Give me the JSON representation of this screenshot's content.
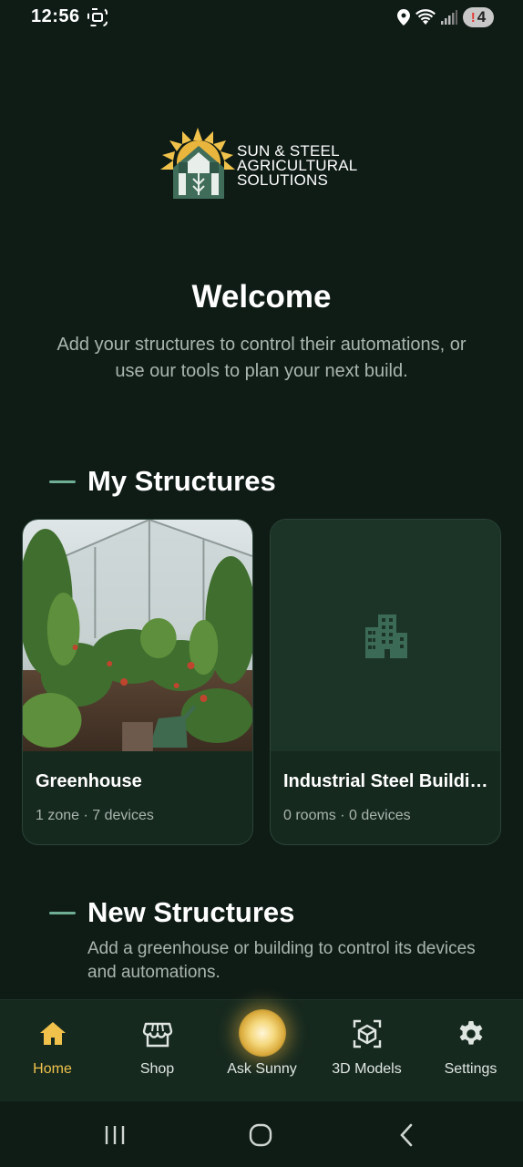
{
  "status_bar": {
    "time": "12:56",
    "battery_level": "4",
    "battery_alert": "!"
  },
  "logo": {
    "line1": "SUN & STEEL",
    "line2": "AGRICULTURAL",
    "line3": "SOLUTIONS"
  },
  "welcome": {
    "title": "Welcome",
    "subtitle": "Add your structures to control their automations, or use our tools to plan your next build."
  },
  "my_structures": {
    "heading": "My Structures",
    "cards": [
      {
        "title": "Greenhouse",
        "meta": "1 zone · 7 devices",
        "icon": "greenhouse-photo"
      },
      {
        "title": "Industrial Steel Building",
        "meta": "0 rooms · 0 devices",
        "icon": "building-icon"
      }
    ]
  },
  "new_structures": {
    "heading": "New Structures",
    "subtitle": "Add a greenhouse or building to control its devices and automations."
  },
  "bottom_nav": {
    "items": [
      {
        "label": "Home",
        "icon": "home-icon",
        "active": true
      },
      {
        "label": "Shop",
        "icon": "store-icon",
        "active": false
      },
      {
        "label": "Ask Sunny",
        "icon": "sunny-orb-icon",
        "active": false
      },
      {
        "label": "3D Models",
        "icon": "cube-scan-icon",
        "active": false
      },
      {
        "label": "Settings",
        "icon": "gear-icon",
        "active": false
      }
    ]
  },
  "colors": {
    "background": "#0f1c16",
    "card": "#16291f",
    "accent": "#6fae95",
    "active_nav": "#f0c24b",
    "muted_text": "#a9b5ae"
  }
}
